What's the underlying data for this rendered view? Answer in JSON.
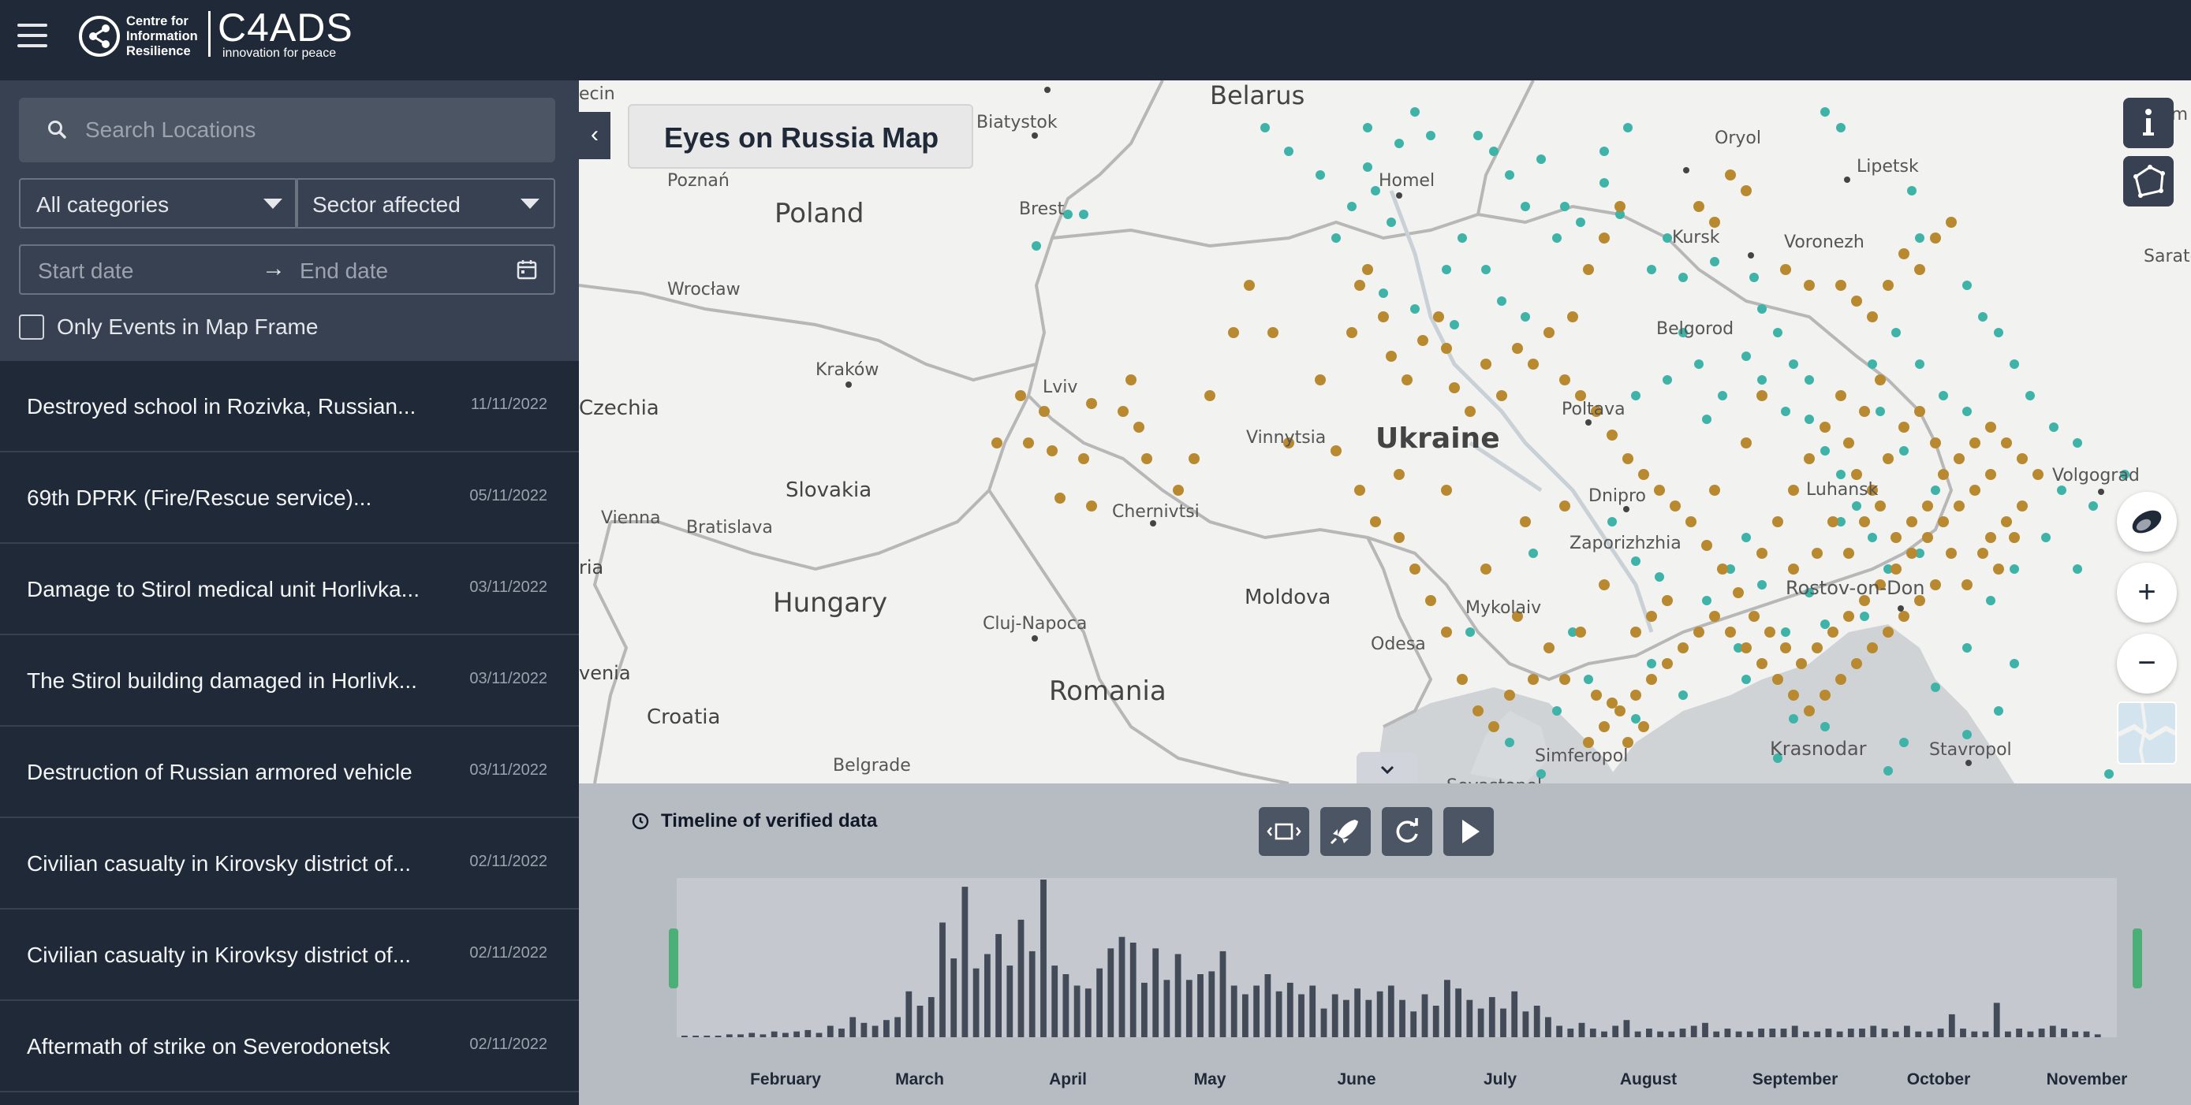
{
  "header": {
    "menu_icon": "hamburger-menu-icon",
    "cir_logo_lines": [
      "Centre for",
      "Information",
      "Resilience"
    ],
    "c4ads_logo": "C4ADS",
    "c4ads_tagline": "innovation for peace"
  },
  "sidebar": {
    "search_placeholder": "Search Locations",
    "category_filter": "All categories",
    "sector_filter": "Sector affected",
    "start_date_placeholder": "Start date",
    "date_separator": "→",
    "end_date_placeholder": "End date",
    "only_events_label": "Only Events in Map Frame",
    "events": [
      {
        "title": "Destroyed school in Rozivka, Russian...",
        "date": "11/11/2022"
      },
      {
        "title": "69th DPRK (Fire/Rescue service)...",
        "date": "05/11/2022"
      },
      {
        "title": "Damage to Stirol medical unit Horlivka...",
        "date": "03/11/2022"
      },
      {
        "title": "The Stirol building damaged in Horlivk...",
        "date": "03/11/2022"
      },
      {
        "title": "Destruction of Russian armored vehicle",
        "date": "03/11/2022"
      },
      {
        "title": "Civilian casualty in Kirovsky district of...",
        "date": "02/11/2022"
      },
      {
        "title": "Civilian casualty in Kirovksy district of...",
        "date": "02/11/2022"
      },
      {
        "title": "Aftermath of strike on Severodonetsk",
        "date": "02/11/2022"
      }
    ]
  },
  "map": {
    "title": "Eyes on Russia Map",
    "collapse_icon": "chevron-left-icon",
    "countries": [
      "Belarus",
      "Poland",
      "Ukraine",
      "Czechia",
      "Slovakia",
      "Hungary",
      "Romania",
      "Moldova",
      "Croatia",
      "ria",
      "venia"
    ],
    "cities": [
      "ecin",
      "Biatystok",
      "Poznań",
      "Brest",
      "Homel",
      "Oryol",
      "Lipetsk",
      "Kursk",
      "Voronezh",
      "Sarato",
      "Perm",
      "Wrocław",
      "Belgorod",
      "Kraków",
      "Lviv",
      "Poltava",
      "Vinnytsia",
      "Dnipro",
      "Luhansk",
      "Volgograd",
      "Vienna",
      "Bratislava",
      "Chernivtsi",
      "Zaporizhzhia",
      "Mykolaiv",
      "Odesa",
      "Rostov-on-Don",
      "Cluj-Napoca",
      "Simferopol",
      "Krasnodar",
      "Stavropol",
      "Belgrade",
      "Sevastopol"
    ],
    "colors": {
      "event_teal": "#40b3a9",
      "event_gold": "#b8892f"
    },
    "controls": [
      "info-icon",
      "draw-area-icon",
      "layers-icon",
      "zoom-in-icon",
      "zoom-out-icon",
      "basemap-toggle-icon"
    ],
    "zoom_in_label": "+",
    "zoom_out_label": "−",
    "expand_icon": "chevron-down-icon"
  },
  "timeline": {
    "title": "Timeline of verified data",
    "buttons": [
      "fit-range-icon",
      "rocket-icon",
      "refresh-icon",
      "play-icon"
    ],
    "months": [
      "February",
      "March",
      "April",
      "May",
      "June",
      "July",
      "August",
      "September",
      "October",
      "November"
    ],
    "daily_counts": [
      1,
      1,
      1,
      1,
      2,
      2,
      3,
      2,
      4,
      3,
      4,
      5,
      3,
      8,
      6,
      14,
      10,
      8,
      12,
      14,
      32,
      22,
      28,
      80,
      55,
      105,
      48,
      58,
      72,
      50,
      82,
      60,
      110,
      50,
      44,
      36,
      34,
      48,
      62,
      70,
      66,
      38,
      62,
      40,
      58,
      40,
      44,
      46,
      60,
      36,
      30,
      36,
      44,
      32,
      38,
      30,
      36,
      20,
      30,
      26,
      34,
      26,
      32,
      36,
      26,
      18,
      30,
      22,
      40,
      34,
      26,
      20,
      28,
      20,
      32,
      18,
      22,
      14,
      8,
      6,
      10,
      6,
      4,
      8,
      12,
      4,
      6,
      4,
      4,
      6,
      8,
      10,
      4,
      6,
      4,
      4,
      6,
      6,
      6,
      8,
      4,
      4,
      6,
      4,
      6,
      6,
      8,
      6,
      4,
      8,
      4,
      4,
      6,
      16,
      6,
      4,
      4,
      24,
      4,
      6,
      4,
      6,
      8,
      6,
      4,
      4,
      2
    ]
  }
}
